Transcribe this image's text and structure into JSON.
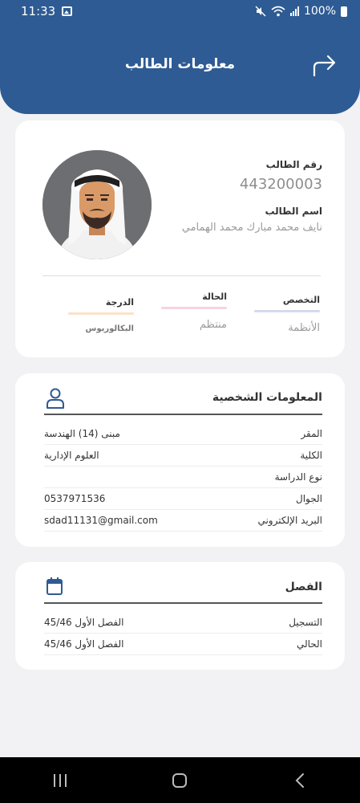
{
  "status_bar": {
    "time": "11:33",
    "battery": "100%"
  },
  "header": {
    "title": "معلومات الطالب"
  },
  "profile": {
    "number_label": "رقم الطالب",
    "number": "443200003",
    "name_label": "اسم الطالب",
    "name": "نايف محمد مبارك محمد الهمامي",
    "major_label": "التخصص",
    "major": "الأنظمة",
    "status_label": "الحالة",
    "status": "منتظم",
    "degree_label": "الدرجة",
    "degree": "البكالوريوس",
    "colors": {
      "major": "#d7d9ee",
      "status": "#f6d4dc",
      "degree": "#f9e2c9"
    }
  },
  "personal": {
    "title": "المعلومات الشخصية",
    "rows": [
      {
        "label": "المقر",
        "value": "مبنى (14) الهندسة"
      },
      {
        "label": "الكلية",
        "value": "العلوم الإدارية"
      },
      {
        "label": "نوع الدراسة",
        "value": ""
      },
      {
        "label": "الجوال",
        "value": "0537971536"
      },
      {
        "label": "البريد الإلكتروني",
        "value": "sdad11131@gmail.com"
      }
    ]
  },
  "semester": {
    "title": "الفصل",
    "rows": [
      {
        "label": "التسجيل",
        "value": "الفصل الأول 45/46"
      },
      {
        "label": "الحالي",
        "value": "الفصل الأول 45/46"
      }
    ]
  },
  "colors": {
    "primary": "#2e5b93",
    "background": "#f2f2f4"
  }
}
